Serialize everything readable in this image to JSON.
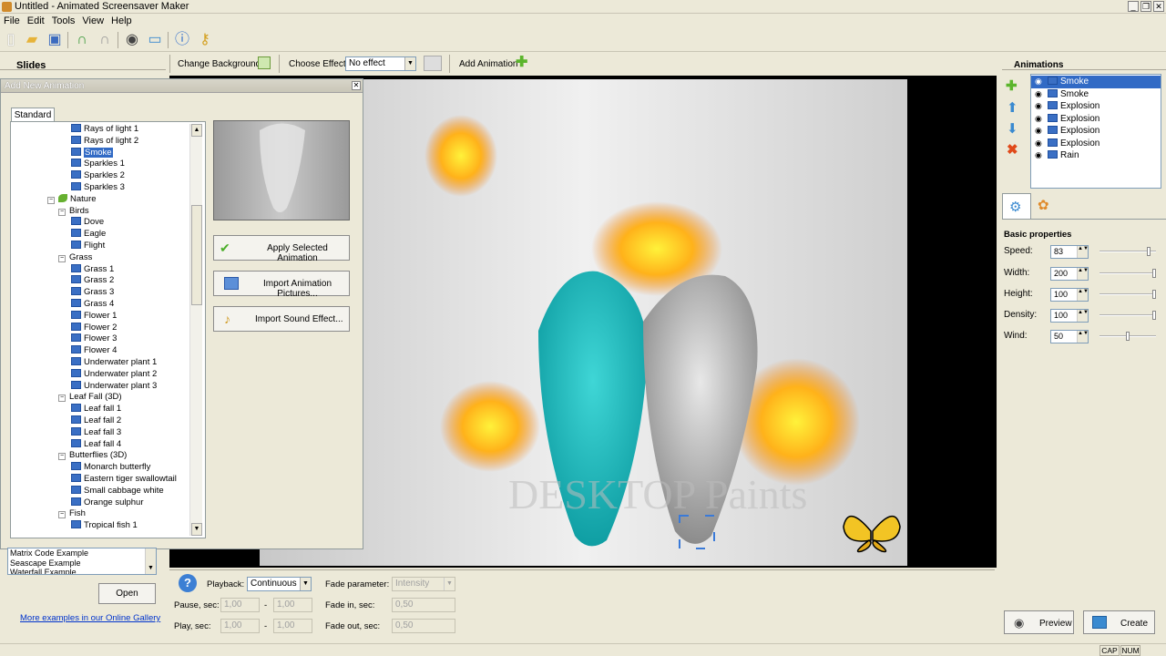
{
  "window": {
    "title": "Untitled - Animated Screensaver Maker"
  },
  "menu": [
    "File",
    "Edit",
    "Tools",
    "View",
    "Help"
  ],
  "left_panel": {
    "slides_header": "Slides"
  },
  "top_bar": {
    "change_background": "Change Background",
    "choose_effect_label": "Choose Effect:",
    "choose_effect_value": "No effect",
    "add_animation": "Add Animation"
  },
  "dialog": {
    "title": "Add New Animation",
    "tab": "Standard",
    "tree": [
      {
        "label": "Rays of light 1",
        "level": 3,
        "type": "item"
      },
      {
        "label": "Rays of light 2",
        "level": 3,
        "type": "item"
      },
      {
        "label": "Smoke",
        "level": 3,
        "type": "item",
        "selected": true
      },
      {
        "label": "Sparkles 1",
        "level": 3,
        "type": "item"
      },
      {
        "label": "Sparkles 2",
        "level": 3,
        "type": "item"
      },
      {
        "label": "Sparkles 3",
        "level": 3,
        "type": "item"
      },
      {
        "label": "Nature",
        "level": 1,
        "type": "folder"
      },
      {
        "label": "Birds",
        "level": 2,
        "type": "group"
      },
      {
        "label": "Dove",
        "level": 3,
        "type": "item"
      },
      {
        "label": "Eagle",
        "level": 3,
        "type": "item"
      },
      {
        "label": "Flight",
        "level": 3,
        "type": "item"
      },
      {
        "label": "Grass",
        "level": 2,
        "type": "group"
      },
      {
        "label": "Grass 1",
        "level": 3,
        "type": "item"
      },
      {
        "label": "Grass 2",
        "level": 3,
        "type": "item"
      },
      {
        "label": "Grass 3",
        "level": 3,
        "type": "item"
      },
      {
        "label": "Grass 4",
        "level": 3,
        "type": "item"
      },
      {
        "label": "Flower 1",
        "level": 3,
        "type": "item"
      },
      {
        "label": "Flower 2",
        "level": 3,
        "type": "item"
      },
      {
        "label": "Flower 3",
        "level": 3,
        "type": "item"
      },
      {
        "label": "Flower 4",
        "level": 3,
        "type": "item"
      },
      {
        "label": "Underwater plant 1",
        "level": 3,
        "type": "item"
      },
      {
        "label": "Underwater plant 2",
        "level": 3,
        "type": "item"
      },
      {
        "label": "Underwater plant 3",
        "level": 3,
        "type": "item"
      },
      {
        "label": "Leaf Fall (3D)",
        "level": 2,
        "type": "group"
      },
      {
        "label": "Leaf fall 1",
        "level": 3,
        "type": "item"
      },
      {
        "label": "Leaf fall 2",
        "level": 3,
        "type": "item"
      },
      {
        "label": "Leaf fall 3",
        "level": 3,
        "type": "item"
      },
      {
        "label": "Leaf fall 4",
        "level": 3,
        "type": "item"
      },
      {
        "label": "Butterflies (3D)",
        "level": 2,
        "type": "group"
      },
      {
        "label": "Monarch butterfly",
        "level": 3,
        "type": "item"
      },
      {
        "label": "Eastern tiger swallowtail",
        "level": 3,
        "type": "item"
      },
      {
        "label": "Small cabbage white",
        "level": 3,
        "type": "item"
      },
      {
        "label": "Orange sulphur",
        "level": 3,
        "type": "item"
      },
      {
        "label": "Fish",
        "level": 2,
        "type": "group"
      },
      {
        "label": "Tropical fish 1",
        "level": 3,
        "type": "item"
      }
    ],
    "apply_button": "Apply Selected Animation",
    "import_pictures_button": "Import Animation Pictures...",
    "import_sound_button": "Import Sound Effect..."
  },
  "examples": {
    "items": [
      "Matrix Code Example",
      "Seascape Example",
      "Waterfall Example"
    ],
    "open_button": "Open",
    "gallery_link": "More examples in our Online Gallery"
  },
  "canvas": {
    "watermark": "DESKTOP Paints"
  },
  "playback": {
    "playback_label": "Playback:",
    "playback_value": "Continuous",
    "pause_label": "Pause, sec:",
    "pause_from": "1,00",
    "pause_to": "1,00",
    "play_label": "Play, sec:",
    "play_from": "1,00",
    "play_to": "1,00",
    "fade_param_label": "Fade parameter:",
    "fade_param_value": "Intensity",
    "fade_in_label": "Fade in, sec:",
    "fade_in_value": "0,50",
    "fade_out_label": "Fade out, sec:",
    "fade_out_value": "0,50",
    "dash": "-"
  },
  "animations_panel": {
    "header": "Animations",
    "items": [
      "Smoke",
      "Smoke",
      "Explosion",
      "Explosion",
      "Explosion",
      "Explosion",
      "Rain"
    ]
  },
  "properties": {
    "header": "Basic properties",
    "rows": [
      {
        "label": "Speed:",
        "value": "83",
        "level": 0.9
      },
      {
        "label": "Width:",
        "value": "200",
        "level": 1.0
      },
      {
        "label": "Height:",
        "value": "100",
        "level": 1.0
      },
      {
        "label": "Density:",
        "value": "100",
        "level": 1.0
      },
      {
        "label": "Wind:",
        "value": "50",
        "level": 0.5
      }
    ]
  },
  "bottom_buttons": {
    "preview": "Preview",
    "create": "Create"
  },
  "status": {
    "cap": "CAP",
    "num": "NUM"
  }
}
